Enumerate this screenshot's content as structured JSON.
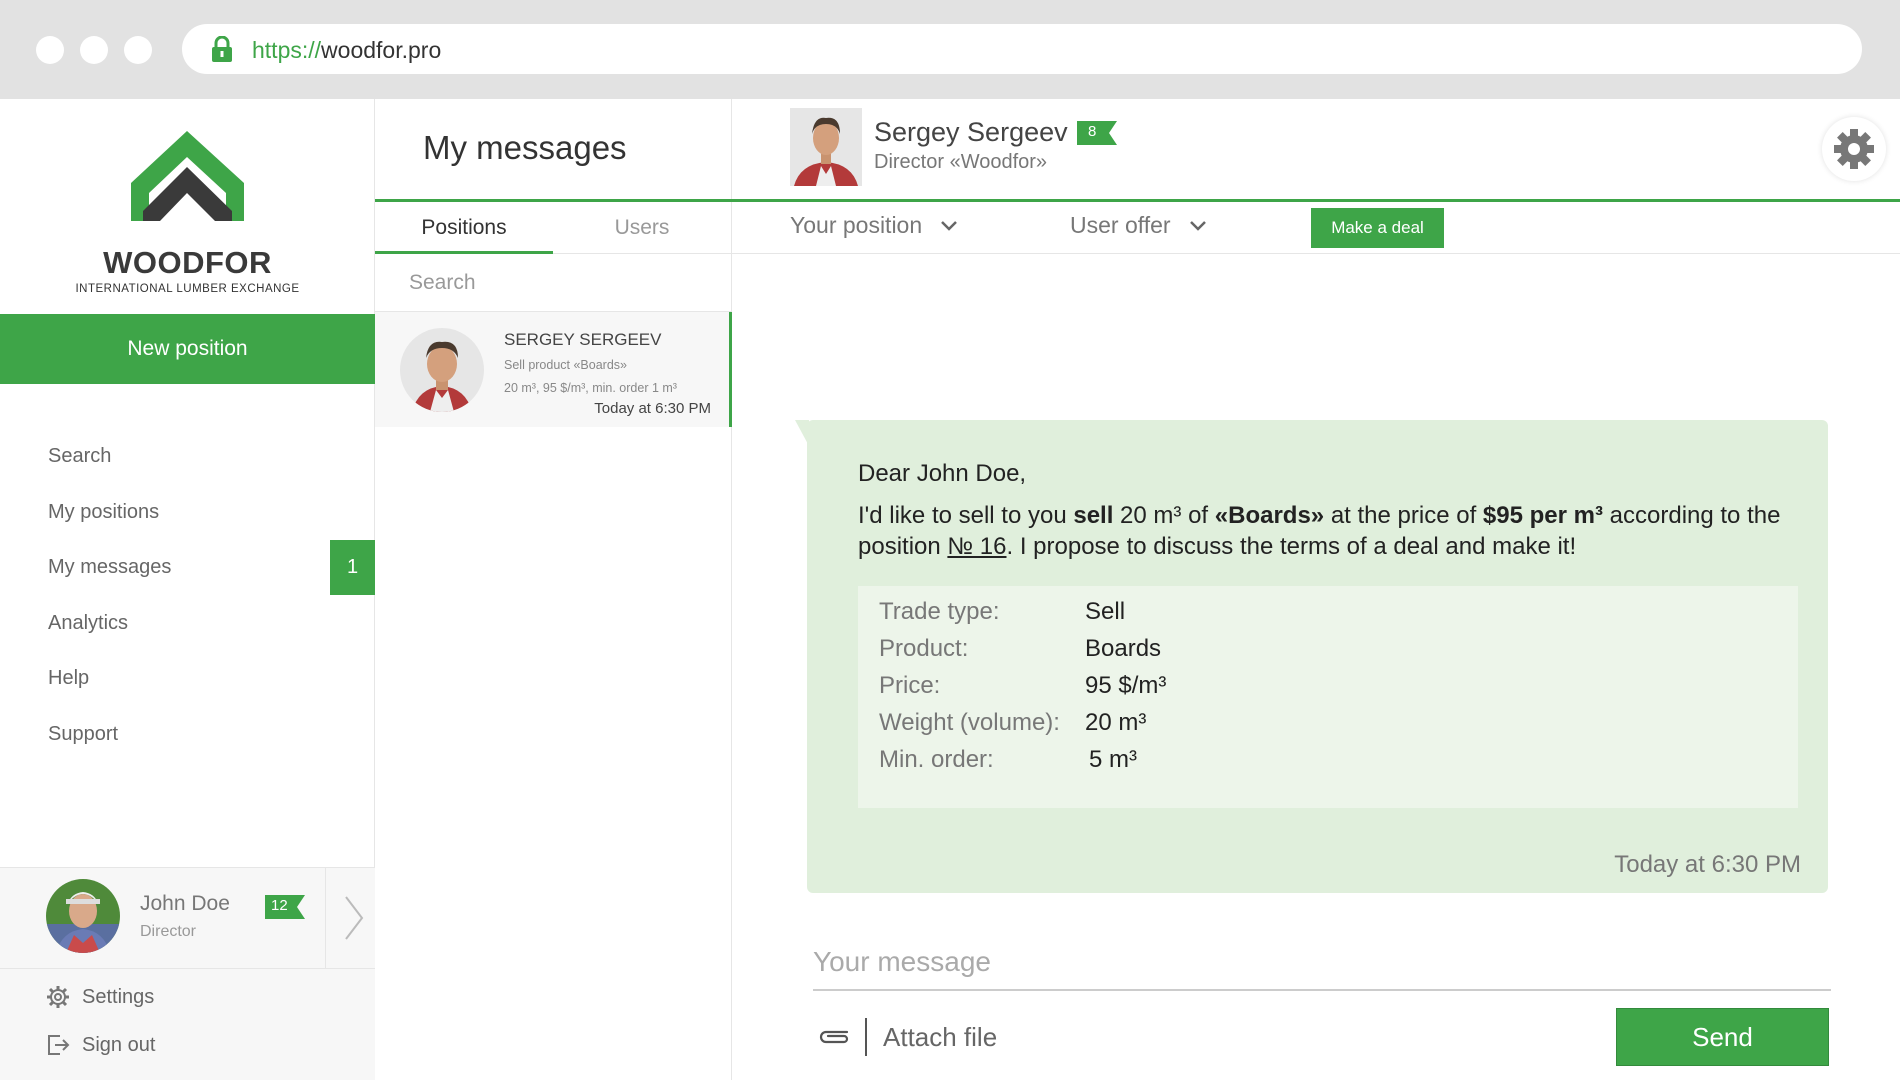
{
  "browser": {
    "url_protocol": "https://",
    "url_host": "woodfor.pro"
  },
  "sidebar": {
    "logo_text": "WOODFOR",
    "logo_subtitle": "INTERNATIONAL LUMBER EXCHANGE",
    "new_position_label": "New position",
    "nav": [
      {
        "label": "Search"
      },
      {
        "label": "My positions"
      },
      {
        "label": "My messages",
        "badge": "1"
      },
      {
        "label": "Analytics"
      },
      {
        "label": "Help"
      },
      {
        "label": "Support"
      }
    ],
    "user": {
      "name": "John Doe",
      "role": "Director",
      "rating": "12"
    },
    "settings_label": "Settings",
    "signout_label": "Sign out"
  },
  "middle": {
    "title": "My messages",
    "tabs": [
      {
        "label": "Positions",
        "active": true
      },
      {
        "label": "Users",
        "active": false
      }
    ],
    "search_placeholder": "Search",
    "conversation": {
      "name": "SERGEY SERGEEV",
      "line1": "Sell product «Boards»",
      "line2": "20 m³, 95 $/m³, min. order 1 m³",
      "time": "Today at 6:30 PM"
    }
  },
  "chat": {
    "contact": {
      "name": "Sergey Sergeev",
      "role": "Director «Woodfor»",
      "rating": "8"
    },
    "your_position_label": "Your position",
    "user_offer_label": "User offer",
    "make_deal_label": "Make a deal",
    "message": {
      "greeting": "Dear John Doe,",
      "t1": "I'd like to sell to you ",
      "b1": "sell",
      "t2": " 20 m³ of ",
      "b2": "«Boards»",
      "t3": " at the price of ",
      "b3": "$95 per m³",
      "t4": " according to the position ",
      "link": "№ 16",
      "t5": ". I propose to discuss the terms of a deal and make it!",
      "details": [
        {
          "label": "Trade type:",
          "value": "Sell"
        },
        {
          "label": "Product:",
          "value": "Boards"
        },
        {
          "label": "Price:",
          "value": "95 $/m³"
        },
        {
          "label": "Weight (volume):",
          "value": "20 m³"
        },
        {
          "label": "Min. order:",
          "value": "5 m³"
        }
      ],
      "time": "Today at 6:30 PM"
    },
    "input_placeholder": "Your message",
    "attach_label": "Attach file",
    "send_label": "Send"
  },
  "colors": {
    "accent": "#3ea548",
    "bubble": "#e0efdc",
    "details_bg": "#edf5ea"
  }
}
